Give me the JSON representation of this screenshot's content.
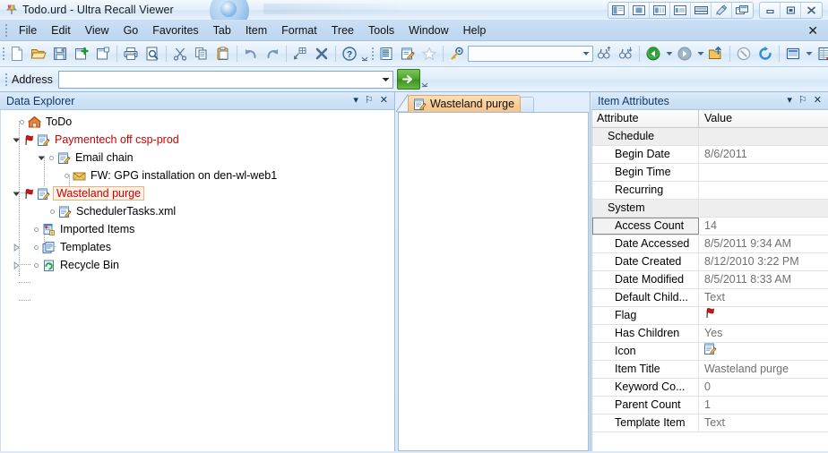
{
  "window": {
    "title": "Todo.urd - Ultra Recall Viewer",
    "app_icon": "pushpin-icon",
    "layout_buttons": [
      {
        "name": "layout-left-pane-icon",
        "label": ""
      },
      {
        "name": "layout-center-pane-icon",
        "label": ""
      },
      {
        "name": "layout-split-pane-icon",
        "label": ""
      },
      {
        "name": "layout-wide-pane-icon",
        "label": ""
      },
      {
        "name": "layout-horizontal-split-icon",
        "label": ""
      },
      {
        "name": "layout-theme-icon",
        "label": ""
      },
      {
        "name": "layout-cascade-icon",
        "label": ""
      }
    ],
    "controls": [
      {
        "name": "minimize-button",
        "glyph": "minimize"
      },
      {
        "name": "maximize-button",
        "glyph": "maximize"
      },
      {
        "name": "close-button",
        "glyph": "close"
      }
    ]
  },
  "menu": {
    "items": [
      {
        "label": "File",
        "name": "menu-file"
      },
      {
        "label": "Edit",
        "name": "menu-edit"
      },
      {
        "label": "View",
        "name": "menu-view"
      },
      {
        "label": "Go",
        "name": "menu-go"
      },
      {
        "label": "Favorites",
        "name": "menu-favorites"
      },
      {
        "label": "Tab",
        "name": "menu-tab"
      },
      {
        "label": "Item",
        "name": "menu-item"
      },
      {
        "label": "Format",
        "name": "menu-format"
      },
      {
        "label": "Tree",
        "name": "menu-tree"
      },
      {
        "label": "Tools",
        "name": "menu-tools"
      },
      {
        "label": "Window",
        "name": "menu-window"
      },
      {
        "label": "Help",
        "name": "menu-help"
      }
    ],
    "close_glyph": "✕"
  },
  "toolbar": {
    "buttons": [
      {
        "name": "new-document-button",
        "icon": "new-document-icon"
      },
      {
        "name": "open-folder-button",
        "icon": "open-folder-icon"
      },
      {
        "name": "save-button",
        "icon": "floppy-disk-icon"
      },
      {
        "name": "new-item-button",
        "icon": "new-item-icon"
      },
      {
        "name": "new-child-item-button",
        "icon": "new-child-item-icon"
      },
      {
        "name": "print-button",
        "icon": "printer-icon"
      },
      {
        "name": "print-preview-button",
        "icon": "print-preview-icon"
      },
      {
        "name": "cut-button",
        "icon": "scissors-icon"
      },
      {
        "name": "copy-button",
        "icon": "copy-icon"
      },
      {
        "name": "paste-button",
        "icon": "clipboard-paste-icon"
      },
      {
        "name": "undo-button",
        "icon": "undo-arrow-icon"
      },
      {
        "name": "redo-button",
        "icon": "redo-arrow-icon"
      },
      {
        "name": "remove-link-button",
        "icon": "remove-link-icon"
      },
      {
        "name": "delete-button",
        "icon": "delete-x-icon"
      },
      {
        "name": "help-button",
        "icon": "question-help-icon"
      },
      {
        "name": "outline-button",
        "icon": "outline-list-icon"
      },
      {
        "name": "edit-item-button",
        "icon": "edit-notepad-icon"
      },
      {
        "name": "favorite-button",
        "icon": "star-icon"
      },
      {
        "name": "search-button",
        "icon": "magnifier-key-icon"
      }
    ],
    "search_field": {
      "name": "search-combo",
      "value": "",
      "placeholder": ""
    },
    "buttons_right": [
      {
        "name": "find-previous-button",
        "icon": "binoculars-up-icon"
      },
      {
        "name": "find-next-button",
        "icon": "binoculars-down-icon"
      },
      {
        "name": "back-button",
        "icon": "back-arrow-icon"
      },
      {
        "name": "back-dropdown",
        "icon": "chevron-down-icon"
      },
      {
        "name": "forward-button",
        "icon": "forward-arrow-icon"
      },
      {
        "name": "forward-dropdown",
        "icon": "chevron-down-icon"
      },
      {
        "name": "up-level-button",
        "icon": "folder-up-icon"
      },
      {
        "name": "stop-button",
        "icon": "stop-circle-icon"
      },
      {
        "name": "refresh-button",
        "icon": "refresh-icon"
      },
      {
        "name": "views-button",
        "icon": "view-pane-icon"
      },
      {
        "name": "views-dropdown",
        "icon": "chevron-down-icon"
      },
      {
        "name": "properties-button",
        "icon": "properties-grid-icon"
      }
    ],
    "overflow_glyph": "⌄"
  },
  "address": {
    "label": "Address",
    "value": "",
    "placeholder": "",
    "dropdown_icon": "chevron-down-icon",
    "go_icon": "green-arrow-go-icon"
  },
  "explorer": {
    "title": "Data Explorer",
    "header_buttons": [
      {
        "name": "panel-menu-button",
        "glyph": "▾"
      },
      {
        "name": "panel-pin-button",
        "glyph": "⚐"
      },
      {
        "name": "panel-close-button",
        "glyph": "✕"
      }
    ],
    "tree": [
      {
        "label": "ToDo",
        "name": "tree-item-todo",
        "icon": "home-icon",
        "depth": 1,
        "state": "leaf",
        "color": "normal",
        "flag": false
      },
      {
        "label": "Paymentech off csp-prod",
        "name": "tree-item-paymentech",
        "icon": "notepad-icon",
        "depth": 1,
        "state": "expanded",
        "color": "red",
        "flag": true
      },
      {
        "label": "Email chain",
        "name": "tree-item-email-chain",
        "icon": "notepad-icon",
        "depth": 2,
        "state": "expanded",
        "color": "normal",
        "flag": false
      },
      {
        "label": "FW: GPG installation on den-wl-web1",
        "name": "tree-item-fw-gpg",
        "icon": "envelope-icon",
        "depth": 3,
        "state": "leaf",
        "color": "normal",
        "flag": false
      },
      {
        "label": "Wasteland purge",
        "name": "tree-item-wasteland-purge",
        "icon": "notepad-icon",
        "depth": 1,
        "state": "expanded",
        "color": "selected",
        "flag": true
      },
      {
        "label": "SchedulerTasks.xml",
        "name": "tree-item-schedulertasks",
        "icon": "notepad-icon",
        "depth": 2,
        "state": "leaf",
        "color": "normal",
        "flag": false
      },
      {
        "label": "Imported Items",
        "name": "tree-item-imported-items",
        "icon": "imported-items-icon",
        "depth": 1,
        "state": "leaf",
        "color": "normal",
        "flag": false
      },
      {
        "label": "Templates",
        "name": "tree-item-templates",
        "icon": "templates-icon",
        "depth": 1,
        "state": "collapsed",
        "color": "normal",
        "flag": false
      },
      {
        "label": "Recycle Bin",
        "name": "tree-item-recycle-bin",
        "icon": "recycle-bin-icon",
        "depth": 1,
        "state": "collapsed",
        "color": "normal",
        "flag": false
      }
    ]
  },
  "center": {
    "tab": {
      "label": "Wasteland purge",
      "icon": "notepad-icon",
      "name": "tab-wasteland-purge"
    },
    "ghost_tab": {
      "name": "tab-placeholder"
    },
    "document_text": ""
  },
  "attributes": {
    "title": "Item Attributes",
    "header_buttons": [
      {
        "name": "panel-menu-button",
        "glyph": "▾"
      },
      {
        "name": "panel-pin-button",
        "glyph": "⚐"
      },
      {
        "name": "panel-close-button",
        "glyph": "✕"
      }
    ],
    "columns": [
      "Attribute",
      "Value"
    ],
    "rows": [
      {
        "attribute": "Schedule",
        "value": "",
        "group": true,
        "selected": false,
        "icon": ""
      },
      {
        "attribute": "Begin Date",
        "value": "8/6/2011",
        "group": false,
        "selected": false,
        "icon": ""
      },
      {
        "attribute": "Begin Time",
        "value": "",
        "group": false,
        "selected": false,
        "icon": ""
      },
      {
        "attribute": "Recurring",
        "value": "",
        "group": false,
        "selected": false,
        "icon": ""
      },
      {
        "attribute": "System",
        "value": "",
        "group": true,
        "selected": false,
        "icon": ""
      },
      {
        "attribute": "Access Count",
        "value": "14",
        "group": false,
        "selected": true,
        "icon": ""
      },
      {
        "attribute": "Date Accessed",
        "value": "8/5/2011 9:34 AM",
        "group": false,
        "selected": false,
        "icon": ""
      },
      {
        "attribute": "Date Created",
        "value": "8/12/2010 3:22 PM",
        "group": false,
        "selected": false,
        "icon": ""
      },
      {
        "attribute": "Date Modified",
        "value": "8/5/2011 8:33 AM",
        "group": false,
        "selected": false,
        "icon": ""
      },
      {
        "attribute": "Default Child...",
        "value": "Text",
        "group": false,
        "selected": false,
        "icon": ""
      },
      {
        "attribute": "Flag",
        "value": "",
        "group": false,
        "selected": false,
        "icon": "red-flag-icon"
      },
      {
        "attribute": "Has Children",
        "value": "Yes",
        "group": false,
        "selected": false,
        "icon": ""
      },
      {
        "attribute": "Icon",
        "value": "",
        "group": false,
        "selected": false,
        "icon": "notepad-icon"
      },
      {
        "attribute": "Item Title",
        "value": "Wasteland purge",
        "group": false,
        "selected": false,
        "icon": ""
      },
      {
        "attribute": "Keyword Co...",
        "value": "0",
        "group": false,
        "selected": false,
        "icon": ""
      },
      {
        "attribute": "Parent Count",
        "value": "1",
        "group": false,
        "selected": false,
        "icon": ""
      },
      {
        "attribute": "Template Item",
        "value": "Text",
        "group": false,
        "selected": false,
        "icon": ""
      }
    ]
  },
  "colors": {
    "accent_blue": "#c3daf2",
    "panel_title": "#0d3a6b",
    "red_item": "#cc0000",
    "tab_orange": "#f9cd97",
    "group_row": "#eeeeee",
    "value_gray": "#707070",
    "go_green": "#4ea52c"
  }
}
